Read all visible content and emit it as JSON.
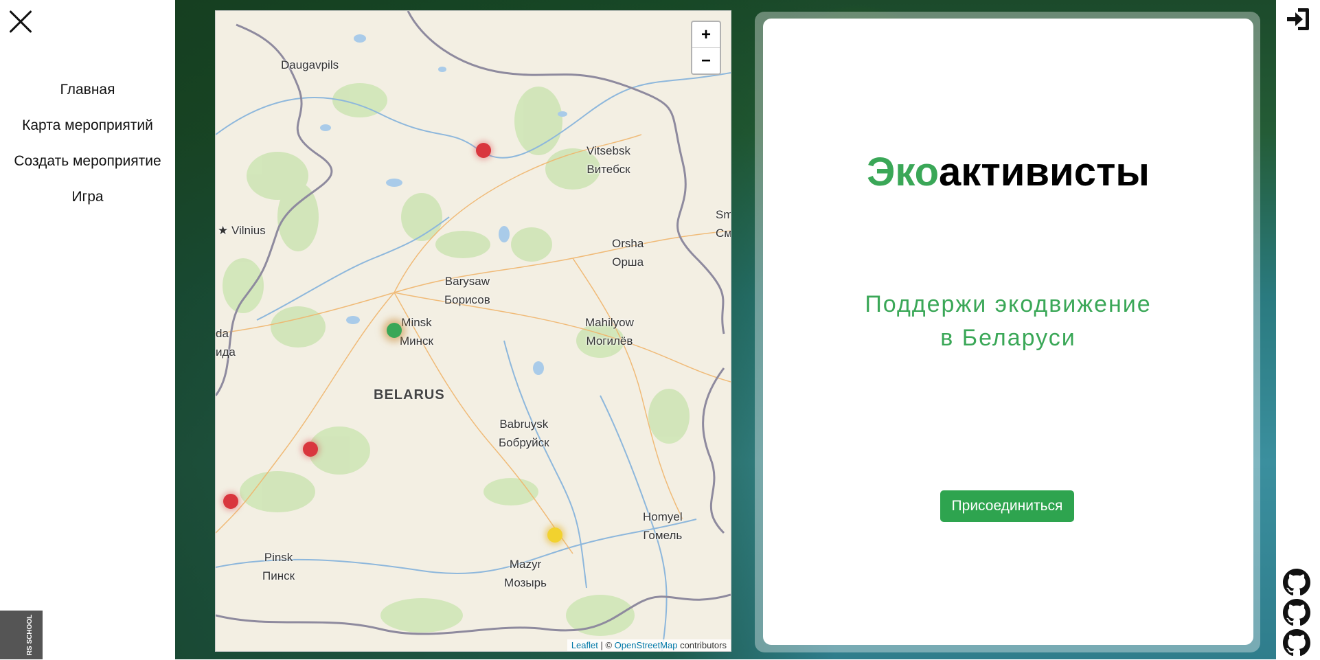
{
  "nav": {
    "items": [
      {
        "label": "Главная"
      },
      {
        "label": "Карта мероприятий"
      },
      {
        "label": "Создать мероприятие"
      },
      {
        "label": "Игра"
      }
    ],
    "school_logo": "RS SCHOOL"
  },
  "map": {
    "zoom_in": "+",
    "zoom_out": "−",
    "attribution": {
      "leaflet": "Leaflet",
      "sep": " | © ",
      "osm": "OpenStreetMap",
      "contributors": " contributors"
    },
    "country": "BELARUS",
    "cities": [
      {
        "en": "Daugavpils",
        "ru": ""
      },
      {
        "en": "Vitsebsk",
        "ru": "Витебск"
      },
      {
        "en": "Vilnius",
        "ru": ""
      },
      {
        "en": "Orsha",
        "ru": "Орша"
      },
      {
        "en": "Barysaw",
        "ru": "Борисов"
      },
      {
        "en": "Minsk",
        "ru": "Минск"
      },
      {
        "en": "Mahilyow",
        "ru": "Могилёв"
      },
      {
        "en": "Babruysk",
        "ru": "Бобруйск"
      },
      {
        "en": "Homyel",
        "ru": "Гомель"
      },
      {
        "en": "Pinsk",
        "ru": "Пинск"
      },
      {
        "en": "Mazyr",
        "ru": "Мозырь"
      },
      {
        "en": "da",
        "ru": "ида"
      },
      {
        "en": "Sm",
        "ru": "См"
      }
    ],
    "marker_colors": {
      "red": "#d9363e",
      "green": "#3aa757",
      "yellow": "#f2d22e"
    }
  },
  "hero": {
    "title_accent": "Эко",
    "title_rest": "активисты",
    "subtitle_line1": "Поддержи экодвижение",
    "subtitle_line2": "в Беларуси",
    "join_label": "Присоединиться"
  },
  "icons": {
    "login": "sign-in-icon",
    "github": "github-icon"
  },
  "colors": {
    "accent": "#3aa757",
    "button": "#2ea44f"
  }
}
